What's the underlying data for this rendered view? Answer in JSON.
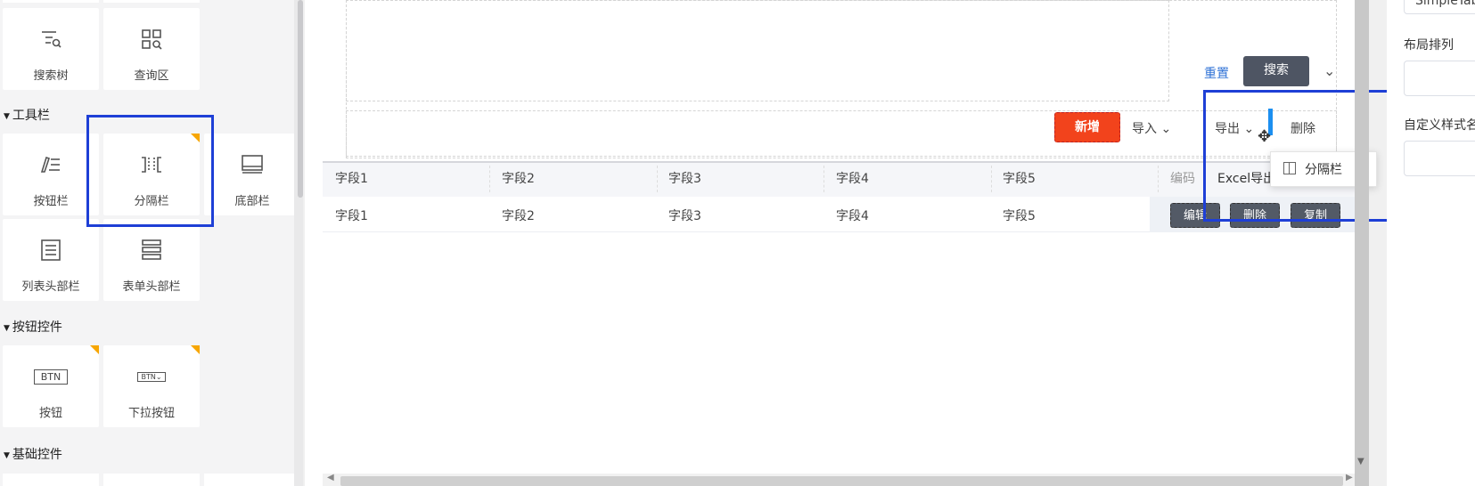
{
  "palette": {
    "row1": [
      {
        "label": "搜索树",
        "icon": "search-tree-icon"
      },
      {
        "label": "查询区",
        "icon": "query-area-icon"
      }
    ],
    "toolbar_section": "工具栏",
    "toolbar_items": [
      {
        "label": "按钮栏",
        "icon": "button-bar-icon"
      },
      {
        "label": "分隔栏",
        "icon": "separator-bar-icon"
      },
      {
        "label": "底部栏",
        "icon": "bottom-bar-icon"
      },
      {
        "label": "列表头部栏",
        "icon": "list-header-icon"
      },
      {
        "label": "表单头部栏",
        "icon": "form-header-icon"
      }
    ],
    "button_section": "按钮控件",
    "button_items": [
      {
        "label": "按钮",
        "icon_text": "BTN"
      },
      {
        "label": "下拉按钮",
        "icon_text": "BTN"
      }
    ],
    "basic_section": "基础控件"
  },
  "canvas": {
    "reset": "重置",
    "search": "搜索",
    "toolbar": {
      "add": "新增",
      "import": "导入",
      "export": "导出",
      "delete": "删除"
    },
    "export_menu": [
      "Excel导出"
    ],
    "drag_ghost": "分隔栏",
    "table": {
      "headers": [
        "字段1",
        "字段2",
        "字段3",
        "字段4",
        "字段5",
        "编码"
      ],
      "rows": [
        [
          "字段1",
          "字段2",
          "字段3",
          "字段4",
          "字段5"
        ]
      ],
      "actions": [
        "编辑",
        "删除",
        "复制"
      ]
    }
  },
  "right_panel": {
    "top_value": "SimpleTab",
    "layout_label": "布局排列",
    "style_label": "自定义样式名"
  },
  "colors": {
    "accent_blue": "#1e3fd6",
    "add_button": "#f2431c",
    "search_button": "#4e5563",
    "corner_badge": "#f7a600"
  }
}
